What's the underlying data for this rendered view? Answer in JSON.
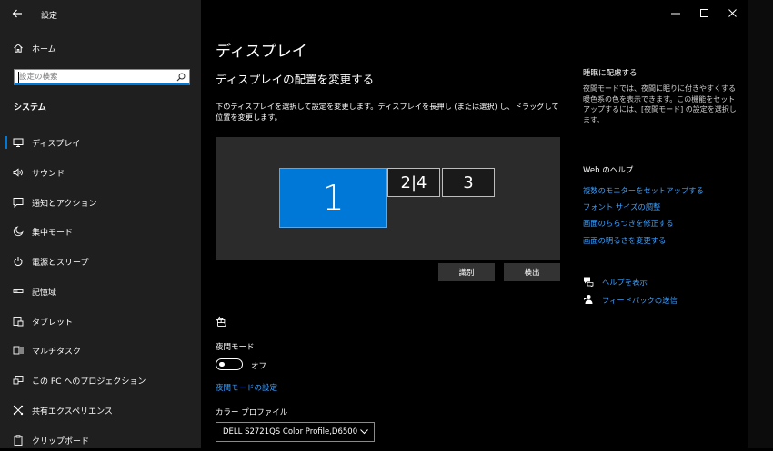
{
  "app": {
    "title": "設定"
  },
  "window_controls": {
    "minimize": "minimize-icon",
    "maximize": "maximize-icon",
    "close": "close-icon"
  },
  "sidebar": {
    "home_label": "ホーム",
    "search_placeholder": "設定の検索",
    "section_heading": "システム",
    "items": [
      {
        "label": "ディスプレイ",
        "icon": "monitor-icon",
        "selected": true
      },
      {
        "label": "サウンド",
        "icon": "speaker-icon"
      },
      {
        "label": "通知とアクション",
        "icon": "notification-icon"
      },
      {
        "label": "集中モード",
        "icon": "moon-icon"
      },
      {
        "label": "電源とスリープ",
        "icon": "power-icon"
      },
      {
        "label": "記憶域",
        "icon": "storage-icon"
      },
      {
        "label": "タブレット",
        "icon": "tablet-icon"
      },
      {
        "label": "マルチタスク",
        "icon": "multitask-icon"
      },
      {
        "label": "この PC へのプロジェクション",
        "icon": "projection-icon"
      },
      {
        "label": "共有エクスペリエンス",
        "icon": "shared-experience-icon"
      },
      {
        "label": "クリップボード",
        "icon": "clipboard-icon"
      }
    ]
  },
  "main": {
    "page_title": "ディスプレイ",
    "arrange_title": "ディスプレイの配置を変更する",
    "arrange_description": "下のディスプレイを選択して設定を変更します。ディスプレイを長押し (または選択) し、ドラッグして位置を変更します。",
    "monitors": [
      {
        "label": "1",
        "selected": true
      },
      {
        "label": "2|4"
      },
      {
        "label": "3"
      }
    ],
    "identify_button": "識別",
    "detect_button": "検出",
    "color_heading": "色",
    "night_mode_label": "夜間モード",
    "night_mode_state": "オフ",
    "night_mode_on": false,
    "night_mode_settings_link": "夜間モードの設定",
    "color_profile_label": "カラー プロファイル",
    "color_profile_value": "DELL S2721QS Color Profile,D6500"
  },
  "right_panel": {
    "sleep_heading": "睡眠に配慮する",
    "sleep_text": "夜間モードでは、夜間に眠りに付きやすくする暖色系の色を表示できます。この機能をセットアップするには、[夜間モード] の設定を選択します。",
    "web_help_heading": "Web のヘルプ",
    "links": [
      "複数のモニターをセットアップする",
      "フォント サイズの調整",
      "画面のちらつきを修正する",
      "画面の明るさを変更する"
    ],
    "get_help_label": "ヘルプを表示",
    "feedback_label": "フィードバックの送信"
  },
  "colors": {
    "accent": "#0078d7",
    "link": "#3aa0ff",
    "sidebar_bg": "#1f1f1f",
    "canvas_bg": "#2b2b2b"
  }
}
